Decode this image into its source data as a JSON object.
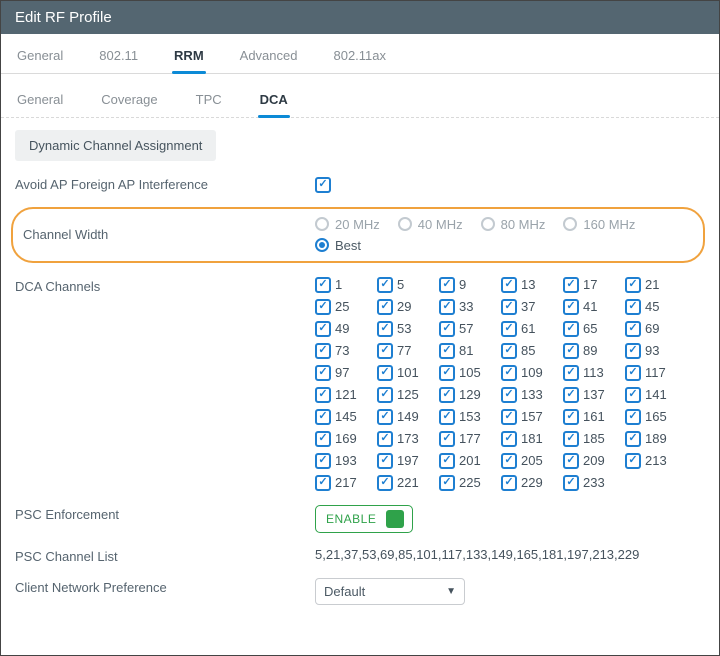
{
  "window_title": "Edit RF Profile",
  "primary_tabs": [
    "General",
    "802.11",
    "RRM",
    "Advanced",
    "802.11ax"
  ],
  "primary_active": 2,
  "sub_tabs": [
    "General",
    "Coverage",
    "TPC",
    "DCA"
  ],
  "sub_active": 3,
  "section_title": "Dynamic Channel Assignment",
  "avoid_label": "Avoid AP Foreign AP Interference",
  "avoid_checked": true,
  "channel_width_label": "Channel Width",
  "cw_options": [
    "20 MHz",
    "40 MHz",
    "80 MHz",
    "160 MHz"
  ],
  "cw_selected": "Best",
  "cw_best_label": "Best",
  "dca_channels_label": "DCA Channels",
  "channels": [
    1,
    5,
    9,
    13,
    17,
    21,
    25,
    29,
    33,
    37,
    41,
    45,
    49,
    53,
    57,
    61,
    65,
    69,
    73,
    77,
    81,
    85,
    89,
    93,
    97,
    101,
    105,
    109,
    113,
    117,
    121,
    125,
    129,
    133,
    137,
    141,
    145,
    149,
    153,
    157,
    161,
    165,
    169,
    173,
    177,
    181,
    185,
    189,
    193,
    197,
    201,
    205,
    209,
    213,
    217,
    221,
    225,
    229,
    233
  ],
  "psc_enforcement_label": "PSC Enforcement",
  "psc_enable_text": "ENABLE",
  "psc_list_label": "PSC Channel List",
  "psc_list_value": "5,21,37,53,69,85,101,117,133,149,165,181,197,213,229",
  "client_pref_label": "Client Network Preference",
  "client_pref_value": "Default"
}
